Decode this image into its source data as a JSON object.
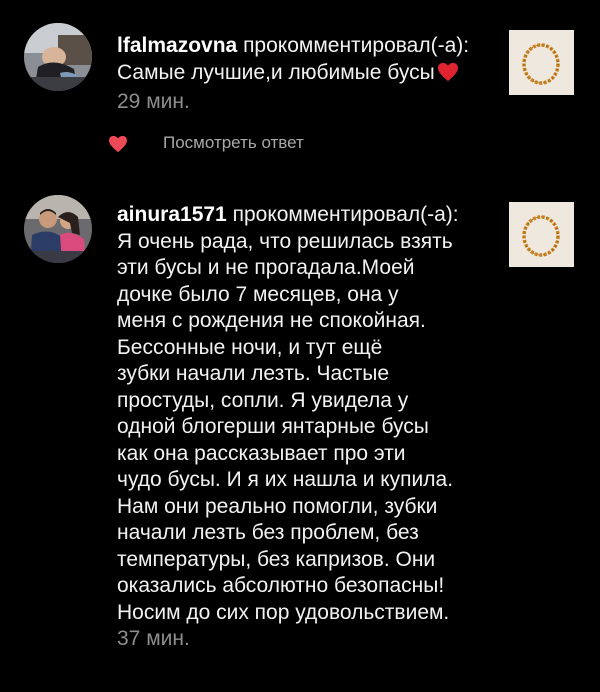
{
  "notifications": [
    {
      "username": "lfalmazovna",
      "action": "прокомментировал(-а):",
      "comment_lines": [
        "Самые лучшие,и любимые бусы"
      ],
      "comment_emoji": "heart-emoji",
      "time": "29 мин."
    },
    {
      "username": "ainura1571",
      "action": "прокомментировал(-а):",
      "comment_lines": [
        "Я очень рада, что решилась взять",
        "эти бусы и не прогадала.Моей",
        "дочке было 7 месяцев, она у",
        "меня с рождения не спокойная.",
        "Бессонные ночи, и тут ещё",
        "зубки начали лезть. Частые",
        "простуды, сопли. Я увидела у",
        "одной блогерши янтарные бусы",
        "как она рассказывает про эти",
        "чудо бусы. И я их нашла и купила.",
        "Нам они реально помогли, зубки",
        "начали лезть без проблем, без",
        "температуры, без капризов. Они",
        "оказались  абсолютно безопасны!",
        "Носим до сих пор удовольствием."
      ],
      "time": "37 мин."
    }
  ],
  "reply": {
    "label": "Посмотреть ответ",
    "icon": "heart-icon"
  },
  "colors": {
    "background": "#000000",
    "text": "#f2f2f2",
    "muted": "#8e8e8e",
    "heart": "#ed4956"
  }
}
